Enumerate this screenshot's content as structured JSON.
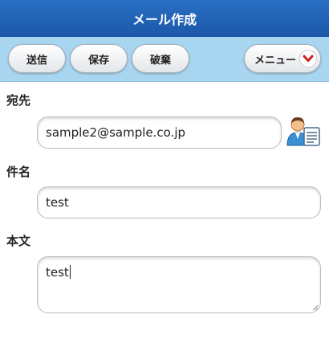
{
  "header": {
    "title": "メール作成"
  },
  "toolbar": {
    "send_label": "送信",
    "save_label": "保存",
    "discard_label": "破棄",
    "menu_label": "メニュー",
    "menu_icon": "chevron-down-icon"
  },
  "form": {
    "to_label": "宛先",
    "to_value": "sample2@sample.co.jp",
    "address_book_icon": "address-book-icon",
    "subject_label": "件名",
    "subject_value": "test",
    "body_label": "本文",
    "body_value": "test"
  },
  "colors": {
    "header_bg": "#1f5fb0",
    "toolbar_bg": "#a8d5f0",
    "menu_chevron": "#cc1f1f"
  }
}
